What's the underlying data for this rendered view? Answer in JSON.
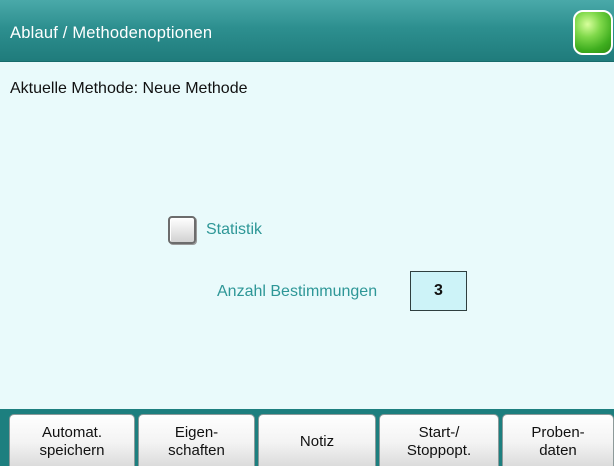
{
  "header": {
    "title": "Ablauf / Methodenoptionen",
    "status_color": "#4cc22a"
  },
  "main": {
    "method_label": "Aktuelle Methode: Neue Methode",
    "statistik": {
      "label": "Statistik",
      "checked": false
    },
    "anzahl": {
      "label": "Anzahl Bestimmungen",
      "value": "3"
    }
  },
  "softkeys": [
    {
      "label": "Automat.\nspeichern"
    },
    {
      "label": "Eigen-\nschaften"
    },
    {
      "label": "Notiz"
    },
    {
      "label": "Start-/\nStoppopt."
    },
    {
      "label": "Proben-\ndaten"
    }
  ],
  "colors": {
    "titlebar": "#2d8f8f",
    "background": "#e9fafb",
    "accent_text": "#2e9797",
    "input_bg": "#cdf3f8"
  }
}
